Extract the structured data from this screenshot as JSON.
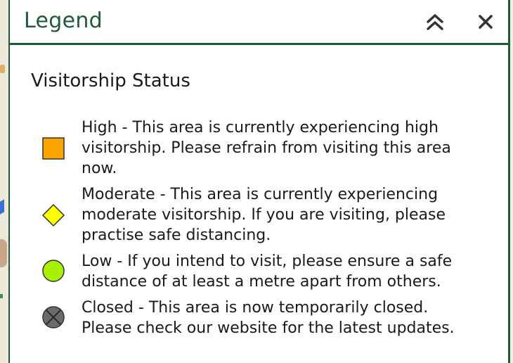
{
  "panel": {
    "title": "Legend",
    "collapse_icon": "double-chevron-up-icon",
    "close_icon": "close-icon"
  },
  "section": {
    "title": "Visitorship Status"
  },
  "items": [
    {
      "status": "high",
      "symbol": "orange-square-icon",
      "color": "#f9a400",
      "text": "High - This area is currently experiencing high visitorship. Please refrain from visiting this area now."
    },
    {
      "status": "moderate",
      "symbol": "yellow-diamond-icon",
      "color": "#ffff00",
      "text": "Moderate - This area is currently experiencing moderate visitorship. If you are visiting, please practise safe distancing."
    },
    {
      "status": "low",
      "symbol": "green-circle-icon",
      "color": "#a6f000",
      "text": "Low - If you intend to visit, please ensure a safe distance of at least a metre apart from others."
    },
    {
      "status": "closed",
      "symbol": "grey-circle-x-icon",
      "color": "#6b6b6b",
      "text": "Closed - This area is now temporarily closed. Please check our website for the latest updates."
    }
  ],
  "colors": {
    "accent": "#1f5a3a",
    "text": "#1a1a1a"
  }
}
